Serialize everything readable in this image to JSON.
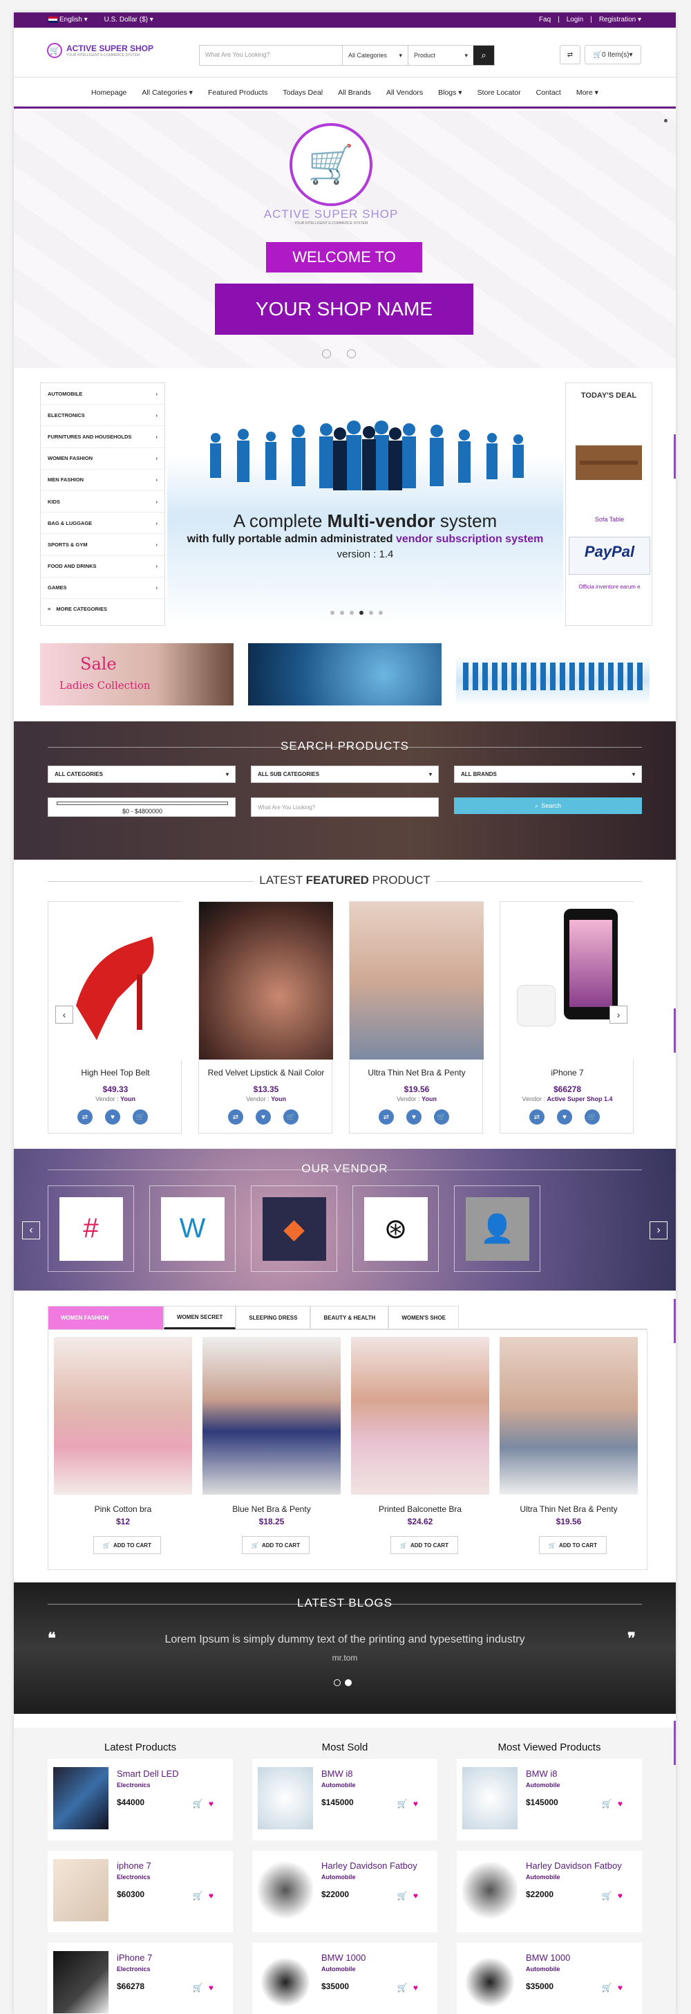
{
  "topbar": {
    "language": "English",
    "currency": "U.S. Dollar ($)",
    "links": [
      "Faq",
      "Login",
      "Registration"
    ]
  },
  "header": {
    "brand": "ACTIVE SUPER SHOP",
    "brand_tagline": "YOUR INTELLIGENT E-COMMERCE SYSTEM",
    "search_placeholder": "What Are You Looking?",
    "search_category": "All Categories",
    "search_type": "Product",
    "cart": "0 Item(s)"
  },
  "nav": [
    "Homepage",
    "All Categories",
    "Featured Products",
    "Todays Deal",
    "All Brands",
    "All Vendors",
    "Blogs",
    "Store Locator",
    "Contact",
    "More"
  ],
  "hero": {
    "brand": "ACTIVE SUPER SHOP",
    "tagline": "YOUR INTELLIGENT E-COMMERCE SYSTEM",
    "welcome": "WELCOME TO",
    "shop_name": "YOUR SHOP NAME"
  },
  "categories": [
    "AUTOMOBILE",
    "ELECTRONICS",
    "FURNITURES AND HOUSEHOLDS",
    "WOMEN FASHION",
    "MEN FASHION",
    "KIDS",
    "BAG & LUGGAGE",
    "SPORTS & GYM",
    "FOOD AND DRINKS",
    "GAMES"
  ],
  "more_categories": "MORE CATEGORIES",
  "main_slide": {
    "line1_pre": "A complete ",
    "line1_bold": "Multi-vendor",
    "line1_post": " system",
    "line2_pre": "with fully portable admin administrated ",
    "line2_link": "vendor subscription system",
    "line3": "version : 1.4"
  },
  "todays_deal": {
    "title": "TODAY'S DEAL",
    "item1": "Sofa Table",
    "item2": "Officia inventore earum e",
    "paypal": "PayPal"
  },
  "promo": {
    "sale": "Sale",
    "ladies": "Ladies Collection"
  },
  "search_products": {
    "title": "SEARCH PRODUCTS",
    "category": "ALL CATEGORIES",
    "subcategory": "ALL SUB CATEGORIES",
    "brand": "ALL BRANDS",
    "price_range": "$0 - $4800000",
    "placeholder": "What Are You Looking?",
    "button": "Search"
  },
  "featured": {
    "title_pre": "LATEST ",
    "title_bold": "FEATURED",
    "title_post": " PRODUCT",
    "vendor_label": "Vendor :",
    "products": [
      {
        "name": "High Heel Top Belt",
        "price": "$49.33",
        "vendor": "Youn"
      },
      {
        "name": "Red Velvet Lipstick & Nail Color",
        "price": "$13.35",
        "vendor": "Youn"
      },
      {
        "name": "Ultra Thin Net Bra & Penty",
        "price": "$19.56",
        "vendor": "Youn"
      },
      {
        "name": "iPhone 7",
        "price": "$66278",
        "vendor": "Active Super Shop 1.4"
      }
    ]
  },
  "our_vendor": {
    "title": "OUR VENDOR"
  },
  "tabs": [
    "WOMEN FASHION",
    "WOMEN SECRET",
    "SLEEPING DRESS",
    "BEAUTY & HEALTH",
    "WOMEN'S SHOE"
  ],
  "tab_products": [
    {
      "name": "Pink Cotton bra",
      "price": "$12"
    },
    {
      "name": "Blue Net Bra & Penty",
      "price": "$18.25"
    },
    {
      "name": "Printed Balconette Bra",
      "price": "$24.62"
    },
    {
      "name": "Ultra Thin Net Bra & Penty",
      "price": "$19.56"
    }
  ],
  "add_to_cart": "ADD TO CART",
  "blogs": {
    "title": "LATEST BLOGS",
    "quote": "Lorem Ipsum is simply dummy text of the printing and typesetting industry",
    "author": "mr.tom"
  },
  "columns": [
    {
      "title": "Latest Products",
      "items": [
        {
          "name": "Smart Dell LED",
          "cat": "Electronics",
          "price": "$44000"
        },
        {
          "name": "iphone 7",
          "cat": "Electronics",
          "price": "$60300"
        },
        {
          "name": "iPhone 7",
          "cat": "Electronics",
          "price": "$66278"
        }
      ]
    },
    {
      "title": "Most Sold",
      "items": [
        {
          "name": "BMW i8",
          "cat": "Automobile",
          "price": "$145000"
        },
        {
          "name": "Harley Davidson Fatboy",
          "cat": "Automobile",
          "price": "$22000"
        },
        {
          "name": "BMW 1000",
          "cat": "Automobile",
          "price": "$35000"
        }
      ]
    },
    {
      "title": "Most Viewed Products",
      "items": [
        {
          "name": "BMW i8",
          "cat": "Automobile",
          "price": "$145000"
        },
        {
          "name": "Harley Davidson Fatboy",
          "cat": "Automobile",
          "price": "$22000"
        },
        {
          "name": "BMW 1000",
          "cat": "Automobile",
          "price": "$35000"
        }
      ]
    }
  ]
}
